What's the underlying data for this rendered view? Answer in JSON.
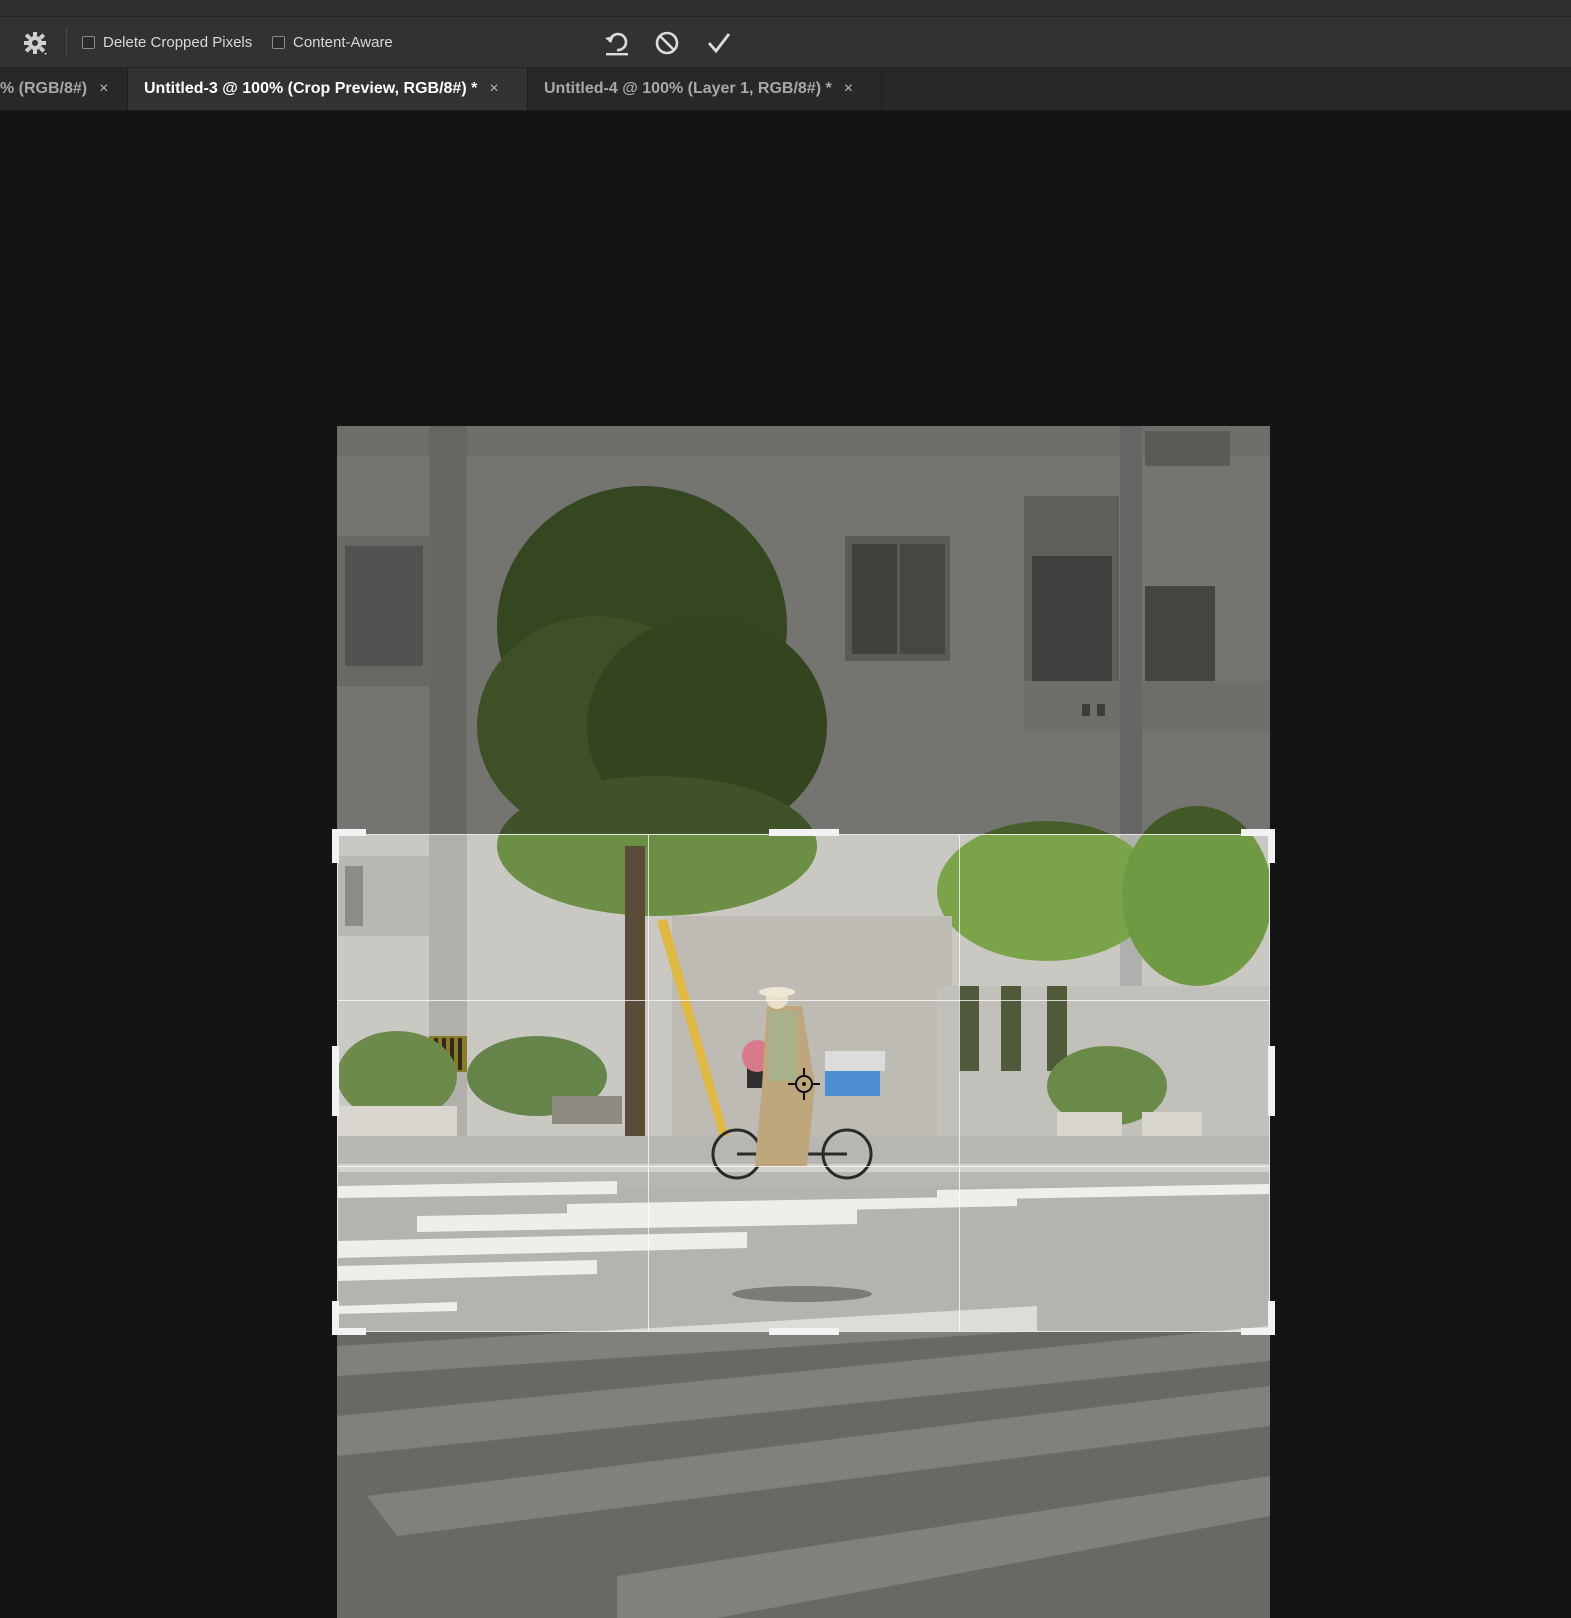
{
  "options_bar": {
    "tool_preset_icon": "gear-icon",
    "delete_cropped_pixels_label": "Delete Cropped Pixels",
    "delete_cropped_pixels_checked": false,
    "content_aware_label": "Content-Aware",
    "content_aware_checked": false,
    "actions": [
      {
        "name": "reset",
        "icon": "reset-icon"
      },
      {
        "name": "cancel",
        "icon": "cancel-icon"
      },
      {
        "name": "commit",
        "icon": "checkmark-icon"
      }
    ]
  },
  "tabs": [
    {
      "label": "% (RGB/8#)",
      "close": "×",
      "active": false
    },
    {
      "label": "Untitled-3 @ 100% (Crop Preview, RGB/8#) *",
      "close": "×",
      "active": true
    },
    {
      "label": "Untitled-4 @ 100% (Layer 1, RGB/8#) *",
      "close": "×",
      "active": false
    }
  ],
  "colors": {
    "app_bg": "#141414",
    "options_bar": "#323232",
    "tab_active": "#323232",
    "tab_inactive": "#282828",
    "handle": "#f2f2f2"
  }
}
